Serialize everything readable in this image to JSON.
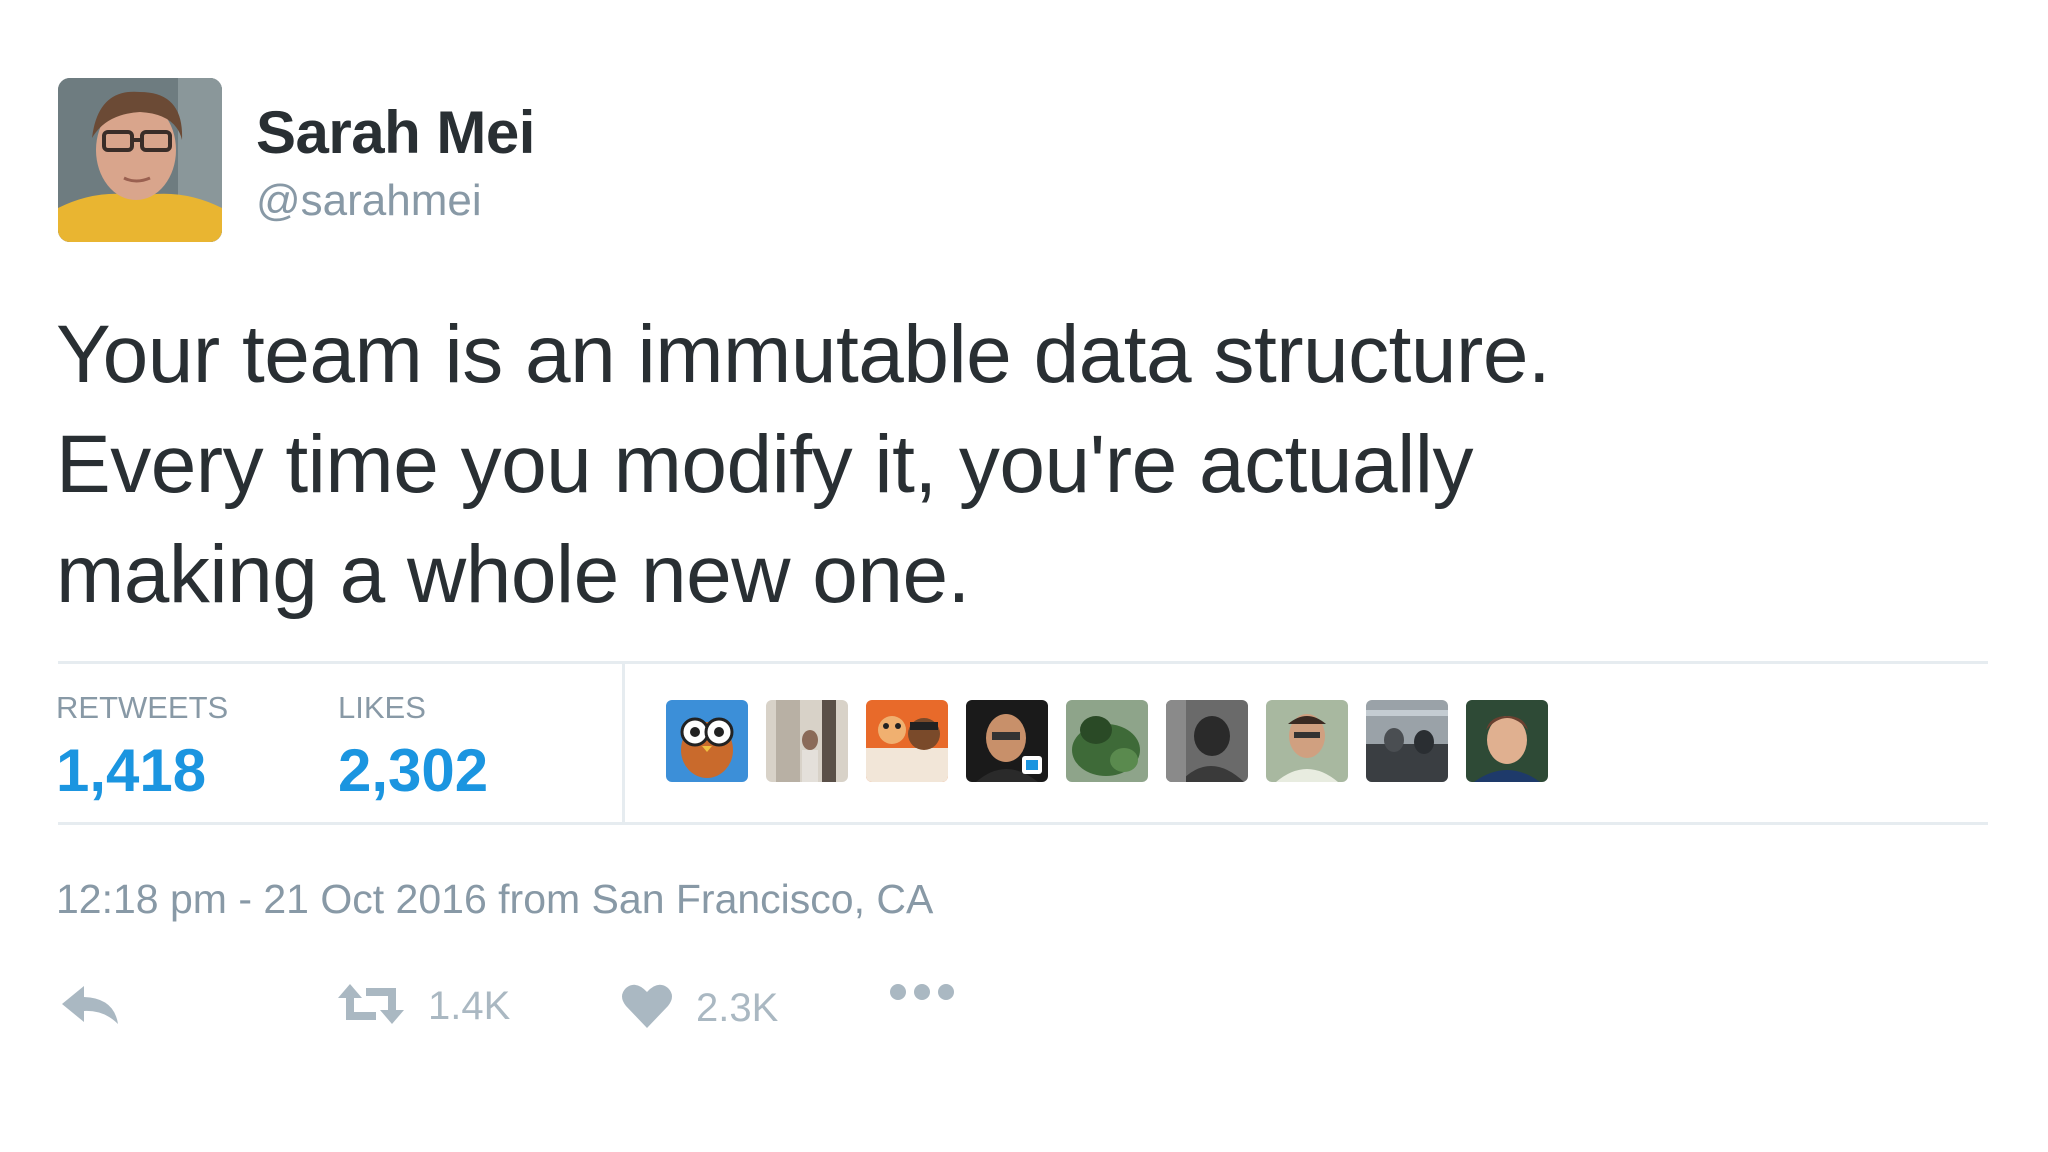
{
  "author": {
    "name": "Sarah Mei",
    "handle": "@sarahmei"
  },
  "tweet": {
    "lines": [
      "Your team is an immutable data structure.",
      "Every time you modify it, you're actually",
      "making a whole new one."
    ],
    "timestamp": "12:18 pm - 21 Oct 2016 from San Francisco, CA"
  },
  "stats": {
    "retweets_label": "RETWEETS",
    "retweets_value": "1,418",
    "likes_label": "LIKES",
    "likes_value": "2,302"
  },
  "actions": {
    "reply_icon": "reply-icon",
    "retweet_icon": "retweet-icon",
    "retweet_count": "1.4K",
    "like_icon": "heart-icon",
    "like_count": "2.3K",
    "more_icon": "more-dots-icon"
  },
  "colors": {
    "link_blue": "#1b95e0",
    "muted_gray": "#8899a6",
    "icon_gray": "#aab8c2",
    "text": "#292f33"
  }
}
